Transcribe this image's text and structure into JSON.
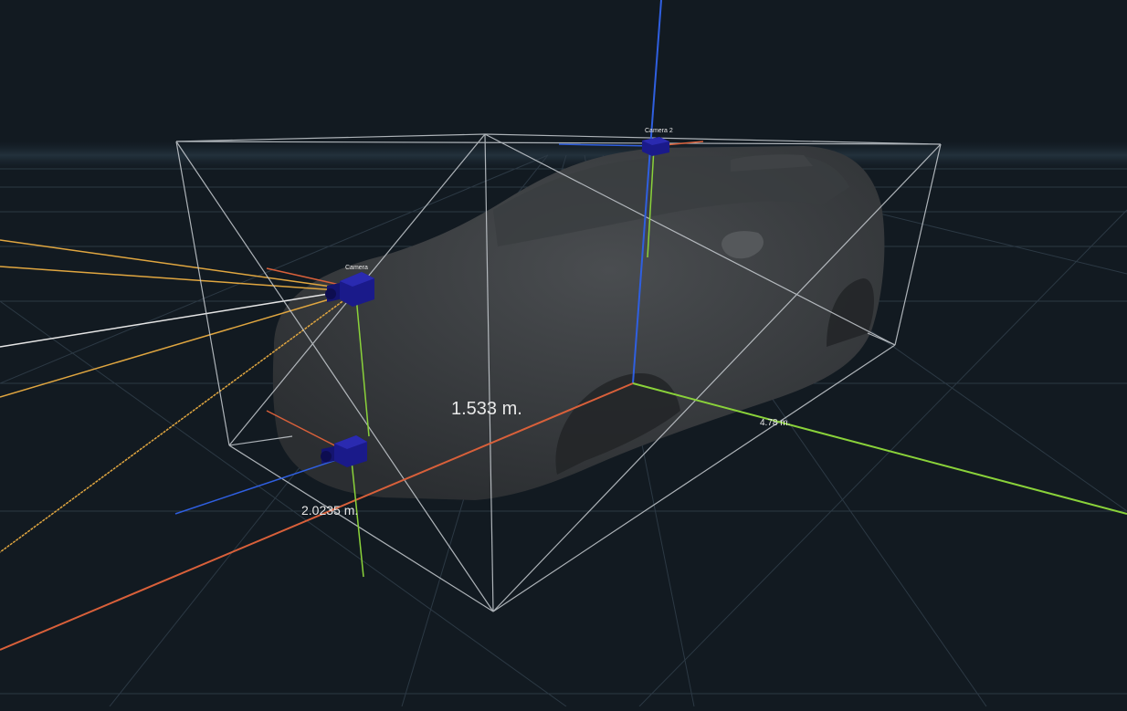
{
  "viewport": {
    "title": "",
    "labels": {
      "height": "1.533 m.",
      "width": "2.0235 m.",
      "length": "4.78 m.",
      "camera_front": "Camera",
      "camera_roof": "Camera 2"
    }
  },
  "colors": {
    "background": "#121a21",
    "grid": "#2c3944",
    "bounding_box": "#c9ced3",
    "axis_x": "#d9603a",
    "axis_y": "#8ad23a",
    "axis_z": "#2f5fe0",
    "sensor_ray": "#e0a640",
    "camera": "#1a1a8a"
  },
  "icons": {
    "camera_front": "camera-cube-icon",
    "camera_bumper": "camera-cube-icon",
    "camera_roof": "camera-cube-icon"
  }
}
